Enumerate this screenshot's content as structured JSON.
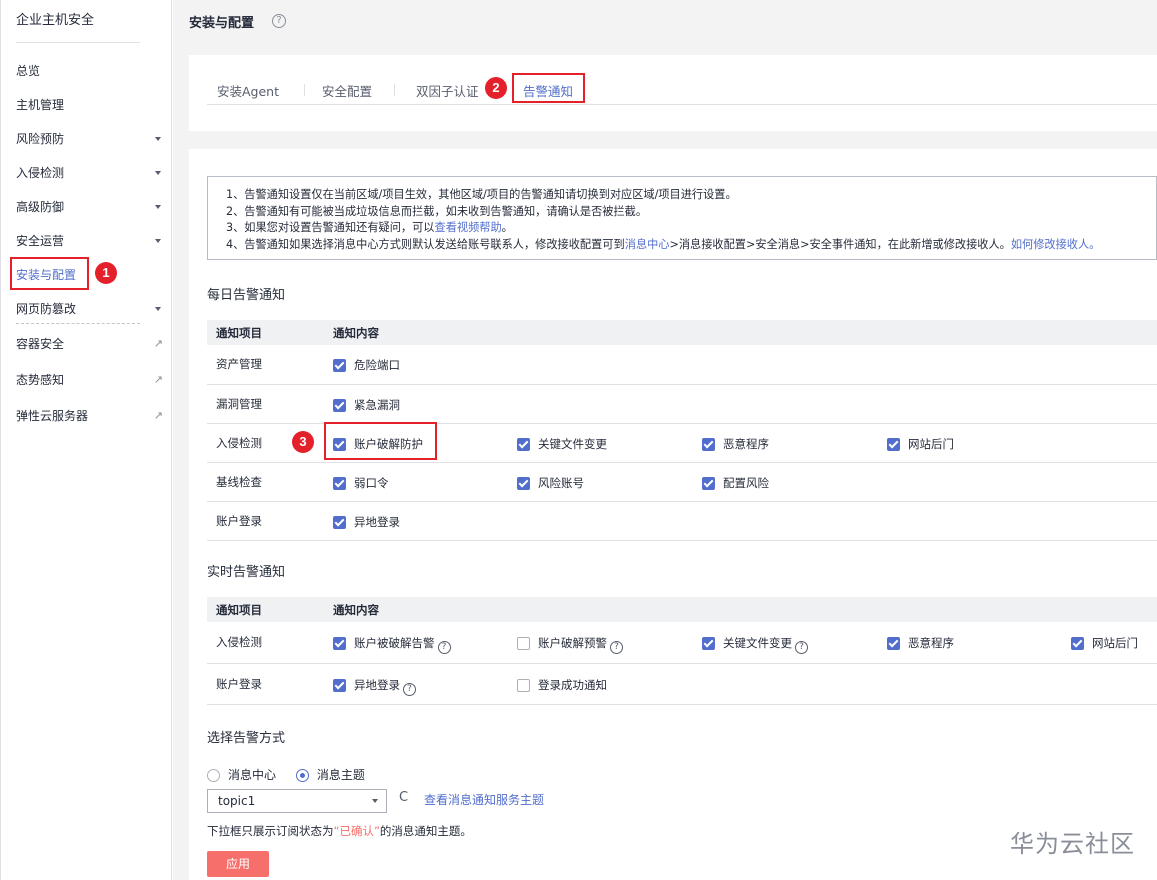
{
  "sidebar": {
    "title": "企业主机安全",
    "items": [
      {
        "label": "总览"
      },
      {
        "label": "主机管理"
      },
      {
        "label": "风险预防"
      },
      {
        "label": "入侵检测"
      },
      {
        "label": "高级防御"
      },
      {
        "label": "安全运营"
      },
      {
        "label": "安装与配置"
      },
      {
        "label": "网页防篡改"
      },
      {
        "label": "容器安全"
      },
      {
        "label": "态势感知"
      },
      {
        "label": "弹性云服务器"
      }
    ],
    "link_icon": "🔗"
  },
  "annotations": {
    "step1": "1",
    "step2": "2",
    "step3": "3",
    "color": "#e4212b"
  },
  "header": {
    "title": "安装与配置",
    "help_icon": "?"
  },
  "tabs": [
    {
      "label": "安装Agent"
    },
    {
      "label": "安全配置"
    },
    {
      "label": "双因子认证"
    },
    {
      "label": "告警通知"
    }
  ],
  "notice": {
    "line1": "1、告警通知设置仅在当前区域/项目生效，其他区域/项目的告警通知请切换到对应区域/项目进行设置。",
    "line2": "2、告警通知有可能被当成垃圾信息而拦截，如未收到告警通知，请确认是否被拦截。",
    "line3_pre": "3、如果您对设置告警通知还有疑问，可以",
    "line3_link": "查看视频帮助",
    "line3_post": "。",
    "line4_a": "4、告警通知如果选择消息中心方式则默认发送给账号联系人，修改接收配置可到",
    "line4_link1": "消息中心",
    "line4_b": ">消息接收配置>安全消息>安全事件通知，在此新增或修改接收人。",
    "line4_link2": "如何修改接收人。"
  },
  "daily": {
    "title": "每日告警通知",
    "col1": "通知项目",
    "col2": "通知内容",
    "rows": [
      {
        "name": "资产管理",
        "opts": [
          {
            "label": "危险端口",
            "checked": true
          }
        ]
      },
      {
        "name": "漏洞管理",
        "opts": [
          {
            "label": "紧急漏洞",
            "checked": true
          }
        ]
      },
      {
        "name": "入侵检测",
        "opts": [
          {
            "label": "账户破解防护",
            "checked": true
          },
          {
            "label": "关键文件变更",
            "checked": true
          },
          {
            "label": "恶意程序",
            "checked": true
          },
          {
            "label": "网站后门",
            "checked": true
          }
        ]
      },
      {
        "name": "基线检查",
        "opts": [
          {
            "label": "弱口令",
            "checked": true
          },
          {
            "label": "风险账号",
            "checked": true
          },
          {
            "label": "配置风险",
            "checked": true
          }
        ]
      },
      {
        "name": "账户登录",
        "opts": [
          {
            "label": "异地登录",
            "checked": true
          }
        ]
      }
    ]
  },
  "realtime": {
    "title": "实时告警通知",
    "col1": "通知项目",
    "col2": "通知内容",
    "rows": [
      {
        "name": "入侵检测",
        "opts": [
          {
            "label": "账户被破解告警",
            "checked": true,
            "help": true
          },
          {
            "label": "账户破解预警",
            "checked": false,
            "help": true
          },
          {
            "label": "关键文件变更",
            "checked": true,
            "help": true
          },
          {
            "label": "恶意程序",
            "checked": true
          },
          {
            "label": "网站后门",
            "checked": true
          }
        ]
      },
      {
        "name": "账户登录",
        "opts": [
          {
            "label": "异地登录",
            "checked": true,
            "help": true
          },
          {
            "label": "登录成功通知",
            "checked": false
          }
        ]
      }
    ]
  },
  "method": {
    "title": "选择告警方式",
    "option1": "消息中心",
    "option2": "消息主题",
    "selected": "消息主题",
    "topic_value": "topic1",
    "refresh_icon": "C",
    "view_link": "查看消息通知服务主题",
    "hint_pre": "下拉框只展示订阅状态为",
    "hint_quoted": "“已确认”",
    "hint_post": "的消息通知主题。",
    "apply_label": "应用"
  },
  "watermark": "华为云社区"
}
